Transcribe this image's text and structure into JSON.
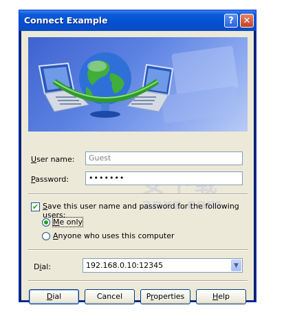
{
  "window": {
    "title": "Connect Example",
    "help_glyph": "?",
    "close_glyph": "✕"
  },
  "form": {
    "username_label_first": "U",
    "username_label_rest": "ser name:",
    "username_value": "Guest",
    "password_label_first": "P",
    "password_label_rest": "assword:",
    "password_value": "•••••••"
  },
  "save_credentials": {
    "checked": true,
    "label_first": "S",
    "label_rest": "ave this user name and password for the following users:",
    "check_glyph": "✔",
    "options": [
      {
        "first": "M",
        "rest": "e only",
        "selected": true
      },
      {
        "first": "A",
        "rest": "nyone who uses this computer",
        "selected": false
      }
    ]
  },
  "dial": {
    "label_start": "D",
    "label_mid": "i",
    "label_end": "al:",
    "value": "192.168.0.10:12345",
    "arrow_glyph": "▼"
  },
  "buttons": {
    "dial": {
      "first": "D",
      "rest": "ial"
    },
    "cancel": "Cancel",
    "properties": {
      "start": "P",
      "mid": "r",
      "end": "operties"
    },
    "help": {
      "first": "H",
      "rest": "elp"
    }
  },
  "watermark": {
    "line1": "安下载",
    "line2": "anxz.com"
  }
}
